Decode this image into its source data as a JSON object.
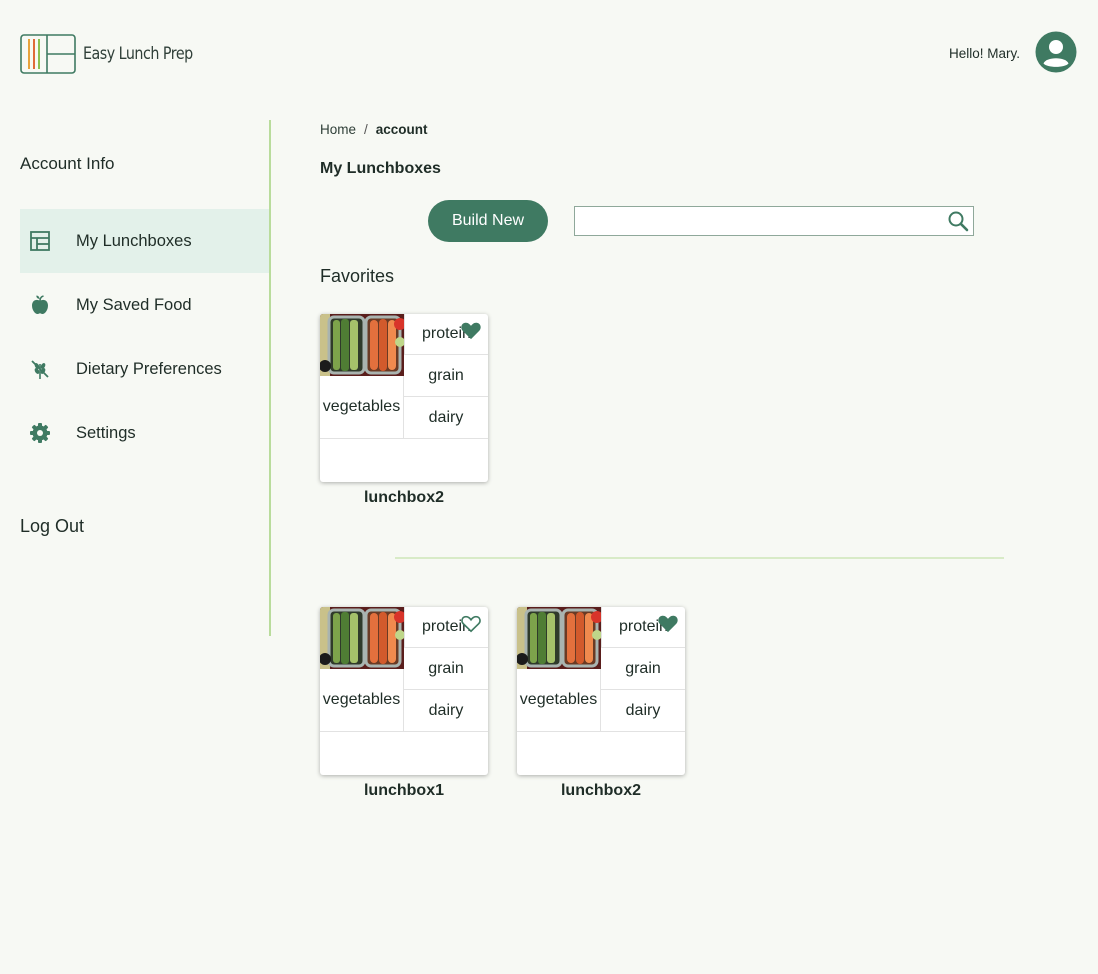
{
  "app": {
    "name": "Easy Lunch Prep",
    "greeting": "Hello! Mary."
  },
  "colors": {
    "accent": "#3f7a62",
    "active_bg": "#e3f1ea",
    "divider": "#b9dc9c",
    "background": "#f7f9f4"
  },
  "sidebar": {
    "title": "Account Info",
    "items": [
      {
        "label": "My Lunchboxes",
        "icon": "layout-icon",
        "active": true
      },
      {
        "label": "My Saved Food",
        "icon": "apple-icon",
        "active": false
      },
      {
        "label": "Dietary Preferences",
        "icon": "wheat-off-icon",
        "active": false
      },
      {
        "label": "Settings",
        "icon": "gear-icon",
        "active": false
      }
    ],
    "logout": "Log Out"
  },
  "breadcrumb": {
    "home": "Home",
    "separator": "/",
    "current": "account"
  },
  "main": {
    "title": "My Lunchboxes",
    "build_button": "Build New",
    "search_value": "",
    "favorites_title": "Favorites"
  },
  "favorites": [
    {
      "name": "lunchbox2",
      "favorited": true,
      "cells": {
        "vegetables": "vegetables",
        "protein": "protein",
        "grain": "grain",
        "dairy": "dairy"
      }
    }
  ],
  "lunchboxes": [
    {
      "name": "lunchbox1",
      "favorited": false,
      "cells": {
        "vegetables": "vegetables",
        "protein": "protein",
        "grain": "grain",
        "dairy": "dairy"
      }
    },
    {
      "name": "lunchbox2",
      "favorited": true,
      "cells": {
        "vegetables": "vegetables",
        "protein": "protein",
        "grain": "grain",
        "dairy": "dairy"
      }
    }
  ]
}
